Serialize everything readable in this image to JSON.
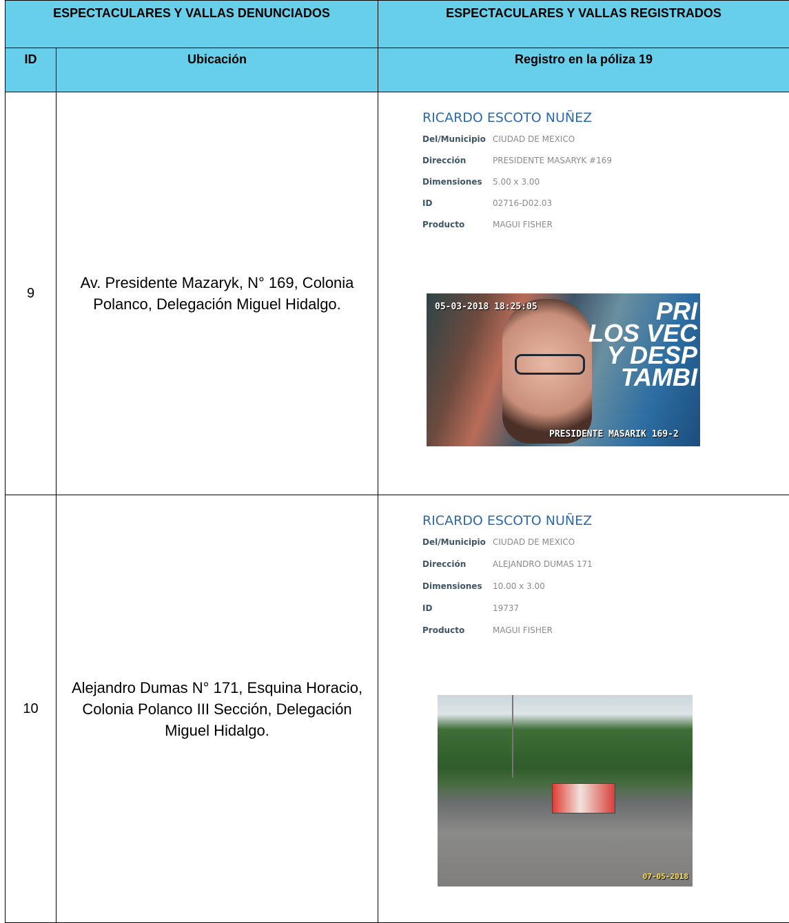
{
  "header": {
    "denunciados": "ESPECTACULARES Y VALLAS DENUNCIADOS",
    "registrados": "ESPECTACULARES Y VALLAS REGISTRADOS",
    "col_id": "ID",
    "col_ubicacion": "Ubicación",
    "col_registro": "Registro en la póliza 19"
  },
  "rows": [
    {
      "id": "9",
      "ubicacion": "Av. Presidente Mazaryk, N° 169, Colonia Polanco, Delegación Miguel Hidalgo.",
      "record": {
        "name": "RICARDO ESCOTO NUÑEZ",
        "fields": [
          {
            "label": "Del/Municipio",
            "value": "CIUDAD DE MEXICO"
          },
          {
            "label": "Dirección",
            "value": "PRESIDENTE MASARYK #169"
          },
          {
            "label": "Dimensiones",
            "value": "5.00 x 3.00"
          },
          {
            "label": "ID",
            "value": "02716-D02.03"
          },
          {
            "label": "Producto",
            "value": "MAGUI FISHER"
          }
        ]
      },
      "photo": {
        "timestamp": "05-03-2018 18:25:05",
        "caption": "PRESIDENTE MASARIK 169-2",
        "overlay": [
          "PRI",
          "LOS VEC",
          "Y DESP",
          "TAMBI"
        ]
      }
    },
    {
      "id": "10",
      "ubicacion": "Alejandro Dumas N° 171, Esquina Horacio, Colonia Polanco III Sección, Delegación Miguel Hidalgo.",
      "record": {
        "name": "RICARDO ESCOTO NUÑEZ",
        "fields": [
          {
            "label": "Del/Municipio",
            "value": "CIUDAD DE MEXICO"
          },
          {
            "label": "Dirección",
            "value": "ALEJANDRO DUMAS 171"
          },
          {
            "label": "Dimensiones",
            "value": "10.00 x 3.00"
          },
          {
            "label": "ID",
            "value": "19737"
          },
          {
            "label": "Producto",
            "value": "MAGUI FISHER"
          }
        ]
      },
      "photo": {
        "date": "07-05-2018"
      }
    }
  ]
}
